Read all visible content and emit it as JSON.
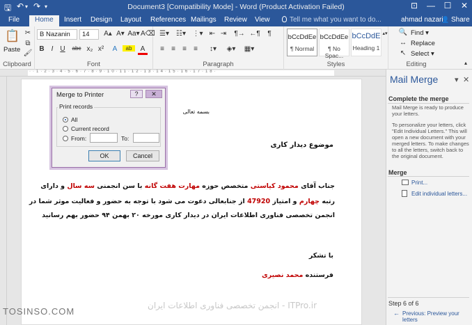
{
  "titlebar": {
    "title": "Document3 [Compatibility Mode] - Word (Product Activation Failed)",
    "save_glyph": "🖫",
    "undo_glyph": "↶",
    "undo_drop": "▾",
    "redo_glyph": "↷",
    "qa_more": "▾",
    "opts_glyph": "⊡",
    "min_glyph": "—",
    "max_glyph": "☐",
    "close_glyph": "✕"
  },
  "tabs": [
    "File",
    "Home",
    "Insert",
    "Design",
    "Layout",
    "References",
    "Mailings",
    "Review",
    "View"
  ],
  "tellme": "Tell me what you want to do...",
  "tellme_icon": "bulb",
  "user": "ahmad nazari",
  "share": "Share",
  "share_icon": "👤",
  "ribbon": {
    "clipboard": {
      "paste": "Paste",
      "label": "Clipboard",
      "paste_glyph": "📋",
      "cut_glyph": "✂",
      "copy_glyph": "⧉",
      "painter_glyph": "🖌"
    },
    "font": {
      "name": "B Nazanin",
      "size": "14",
      "label": "Font",
      "grow": "A▴",
      "shrink": "A▾",
      "case": "Aa▾",
      "clear": "A⌫",
      "bold": "B",
      "italic": "I",
      "underline": "U",
      "strike": "abc",
      "sub": "x₂",
      "sup": "x²",
      "effects": "A",
      "highlight": "ab",
      "color": "A"
    },
    "paragraph": {
      "label": "Paragraph",
      "bullets": "☰▾",
      "numbering": "☷▾",
      "multilevel": "⋮▾",
      "decrease": "⇤",
      "increase": "⇥",
      "ltr": "¶→",
      "rtl": "←¶",
      "show": "¶",
      "align": [
        "≡",
        "≡",
        "≡",
        "≡"
      ],
      "spacing": "↕▾",
      "shading": "◈▾",
      "borders": "▦▾"
    },
    "styles": {
      "label": "Styles",
      "items": [
        {
          "preview": "bCcDdEe",
          "name": "¶ Normal"
        },
        {
          "preview": "bCcDdEe",
          "name": "¶ No Spac..."
        },
        {
          "preview": "bCcDdE",
          "name": "Heading 1"
        }
      ],
      "more": "▴▾"
    },
    "editing": {
      "label": "Editing",
      "find": "Find ▾",
      "replace": "Replace",
      "select": "Select ▾",
      "find_glyph": "🔍",
      "replace_glyph": "↔",
      "select_glyph": "↖"
    },
    "collapse": "▴"
  },
  "ruler_marks": "··1·2·3·4·5·6·7·8·9·10·11·12·13·14·15·16·17·18·",
  "document": {
    "basmala": "بسمه تعالی",
    "subject": "موضوع دیدار کاری",
    "line1": {
      "a": "جناب آقای ",
      "b": "محمود کیاستی",
      "c": " متخصص حوزه ",
      "d": "مهارت هفت گانه",
      "e": "  با سن انجمنی ",
      "f": "سه سال",
      "g": " و دارای"
    },
    "line2": {
      "a": "رتبه ",
      "b": "چهارم",
      "c": " و امتیاز ",
      "d": "47920",
      "e": " از جنابعالی دعوت می شود با توجه به حضور و فعالیت موثر شما در"
    },
    "line3": "انجمن تخصصی فناوری اطلاعات ایران در دیدار کاری مورخه ۲۰ بهمن ۹۴ حضور بهم رسانید",
    "thanks": "با تشکر",
    "sender_label": "فرستنده ",
    "sender_name": "محمد نصیری"
  },
  "dialog": {
    "title": "Merge to Printer",
    "help": "?",
    "close": "✕",
    "group": "Print records",
    "options": [
      "All",
      "Current record",
      "From:"
    ],
    "to": "To:",
    "ok": "OK",
    "cancel": "Cancel"
  },
  "pane": {
    "title": "Mail Merge",
    "dropdown": "▾",
    "close": "✕",
    "section1": "Complete the merge",
    "text1": "Mail Merge is ready to produce your letters.",
    "text2": "To personalize your letters, click \"Edit Individual Letters.\" This will open a new document with your merged letters. To make changes to all the letters, switch back to the original document.",
    "section2": "Merge",
    "print": "Print...",
    "edit": "Edit individual letters...",
    "step": "Step 6 of 6",
    "prev": "Previous: Preview your letters"
  },
  "watermark": "ITPro.ir - انجمن تخصصی فناوری اطلاعات ایران",
  "tosinso": "TOSINSO.COM"
}
